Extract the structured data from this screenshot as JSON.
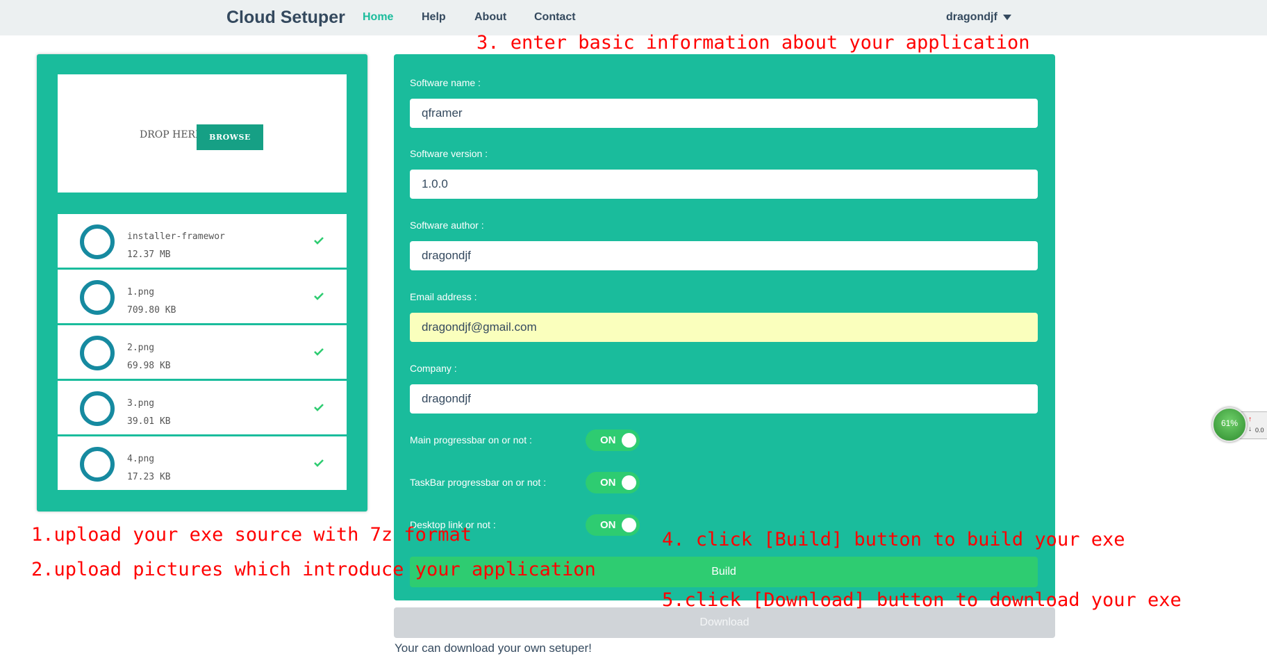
{
  "nav": {
    "brand": "Cloud Setuper",
    "links": [
      "Home",
      "Help",
      "About",
      "Contact"
    ],
    "user": "dragondjf"
  },
  "upload": {
    "drop_label": "DROP HERE",
    "browse_label": "BROWSE",
    "files": [
      {
        "name": "installer-framewor",
        "size": "12.37 MB"
      },
      {
        "name": "1.png",
        "size": "709.80 KB"
      },
      {
        "name": "2.png",
        "size": "69.98 KB"
      },
      {
        "name": "3.png",
        "size": "39.01 KB"
      },
      {
        "name": "4.png",
        "size": "17.23 KB"
      }
    ]
  },
  "form": {
    "software_name": {
      "label": "Software name :",
      "value": "qframer"
    },
    "software_version": {
      "label": "Software version :",
      "value": "1.0.0"
    },
    "software_author": {
      "label": "Software author :",
      "value": "dragondjf"
    },
    "email": {
      "label": "Email address :",
      "value": "dragondjf@gmail.com"
    },
    "company": {
      "label": "Company :",
      "value": "dragondjf"
    },
    "toggles": [
      {
        "label": "Main progressbar on or not :",
        "state": "ON"
      },
      {
        "label": "TaskBar progressbar on or not :",
        "state": "ON"
      },
      {
        "label": "Desktop link or not :",
        "state": "ON"
      }
    ],
    "build_label": "Build"
  },
  "download_label": "Download",
  "note": "Your can download your own setuper!",
  "annotations": {
    "step1": "1.upload your exe source with 7z format",
    "step2": "2.upload pictures which introduce your application",
    "step3": "3. enter basic information about your application",
    "step4": "4. click [Build] button to build your exe",
    "step5": "5.click [Download] button to download your exe"
  },
  "widget": {
    "percent": "61%",
    "up": "↑",
    "down": "↓",
    "speed": "0.0"
  },
  "colors": {
    "accent": "#1abc9c",
    "green": "#2ecc71",
    "dark": "#34495e",
    "annotation": "#ff0000"
  }
}
